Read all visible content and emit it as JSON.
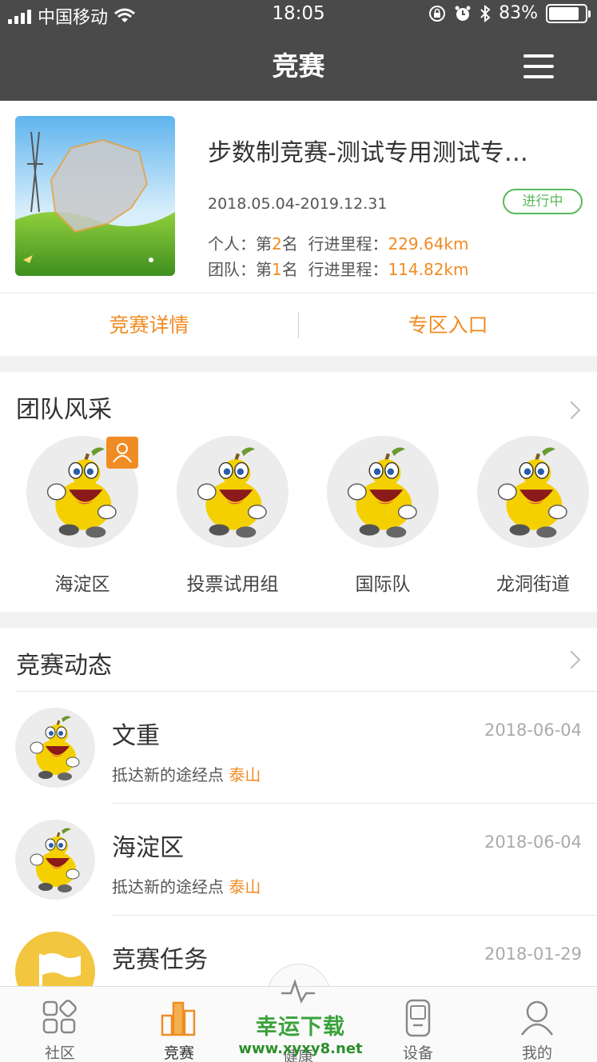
{
  "status_bar": {
    "carrier": "中国移动",
    "time": "18:05",
    "battery_percent": "83%",
    "battery_level": 0.83,
    "icons": [
      "signal-icon",
      "wifi-icon",
      "rotation-lock-icon",
      "alarm-icon",
      "bluetooth-icon",
      "battery-icon"
    ]
  },
  "nav": {
    "title": "竞赛",
    "menu_icon": "hamburger-menu-icon"
  },
  "competition": {
    "title": "步数制竞赛-测试专用测试专…",
    "date_range": "2018.05.04-2019.12.31",
    "status_badge": "进行中",
    "personal": {
      "label": "个人：第",
      "rank": "2",
      "rank_suffix": "名",
      "distance_label": "行进里程：",
      "distance": "229.64km"
    },
    "team": {
      "label": "团队：第",
      "rank": "1",
      "rank_suffix": "名",
      "distance_label": "行进里程：",
      "distance": "114.82km"
    },
    "actions": {
      "details": "竞赛详情",
      "zone": "专区入口"
    }
  },
  "team_section": {
    "title": "团队风采",
    "members": [
      {
        "name": "海淀区",
        "is_mine": true
      },
      {
        "name": "投票试用组"
      },
      {
        "name": "国际队"
      },
      {
        "name": "龙洞街道"
      }
    ]
  },
  "feed_section": {
    "title": "竞赛动态",
    "items": [
      {
        "name": "文重",
        "date": "2018-06-04",
        "desc": "抵达新的途经点",
        "place": "泰山",
        "avatar": "mascot"
      },
      {
        "name": "海淀区",
        "date": "2018-06-04",
        "desc": "抵达新的途经点",
        "place": "泰山",
        "avatar": "mascot"
      },
      {
        "name": "竞赛任务",
        "date": "2018-01-29",
        "avatar": "flag-icon"
      }
    ]
  },
  "tabbar": {
    "tabs": [
      {
        "label": "社区",
        "icon": "community-icon"
      },
      {
        "label": "竞赛",
        "icon": "competition-icon",
        "active": true
      },
      {
        "label": "健康",
        "icon": "health-icon"
      },
      {
        "label": "设备",
        "icon": "device-icon"
      },
      {
        "label": "我的",
        "icon": "profile-icon"
      }
    ]
  },
  "watermark": {
    "line1": "幸运下载",
    "line2": "www.xyxy8.net"
  },
  "colors": {
    "accent": "#f08c24",
    "nav_bg": "#4a4a4a",
    "status_green": "#5bb85d",
    "mascot_yellow": "#f5d000"
  }
}
